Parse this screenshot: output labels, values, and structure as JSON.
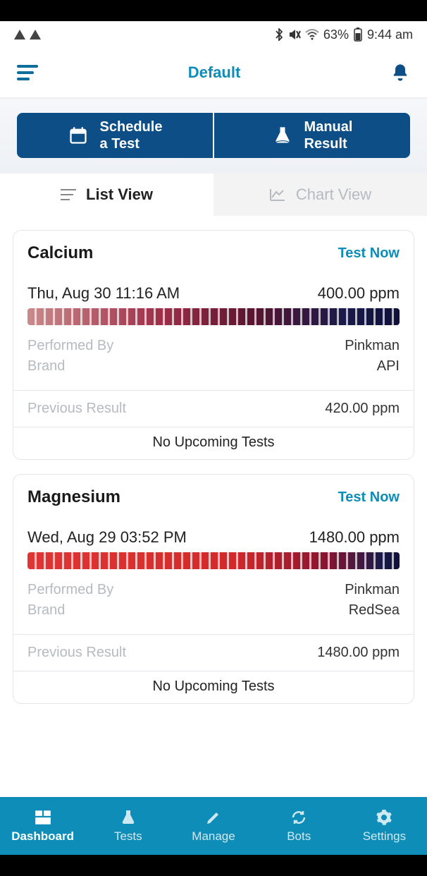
{
  "status": {
    "battery": "63%",
    "time": "9:44 am"
  },
  "header": {
    "title": "Default"
  },
  "actions": {
    "schedule": "Schedule\na Test",
    "manual": "Manual\nResult"
  },
  "view_tabs": {
    "list": "List View",
    "chart": "Chart View"
  },
  "labels": {
    "performed_by": "Performed By",
    "brand": "Brand",
    "previous_result": "Previous Result",
    "no_upcoming": "No Upcoming Tests",
    "test_now": "Test Now"
  },
  "tests": [
    {
      "name": "Calcium",
      "datetime": "Thu, Aug 30 11:16 AM",
      "value": "400.00 ppm",
      "performed_by": "Pinkman",
      "brand": "API",
      "previous": "420.00 ppm",
      "gradient": "cal"
    },
    {
      "name": "Magnesium",
      "datetime": "Wed, Aug 29 03:52 PM",
      "value": "1480.00 ppm",
      "performed_by": "Pinkman",
      "brand": "RedSea",
      "previous": "1480.00 ppm",
      "gradient": "mag"
    }
  ],
  "nav": {
    "dashboard": "Dashboard",
    "tests": "Tests",
    "manage": "Manage",
    "bots": "Bots",
    "settings": "Settings"
  }
}
